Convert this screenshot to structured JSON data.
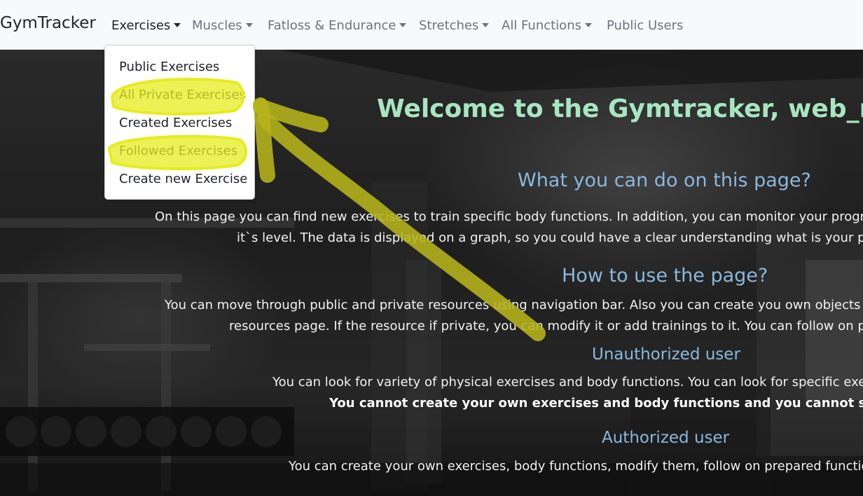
{
  "navbar": {
    "brand": "GymTracker",
    "items": [
      {
        "label": "Exercises"
      },
      {
        "label": "Muscles"
      },
      {
        "label": "Fatloss & Endurance"
      },
      {
        "label": "Stretches"
      },
      {
        "label": "All Functions"
      },
      {
        "label": "Public Users"
      }
    ]
  },
  "dropdown": {
    "items": [
      {
        "label": "Public Exercises"
      },
      {
        "label": "All Private Exercises"
      },
      {
        "label": "Created Exercises"
      },
      {
        "label": "Followed Exercises"
      },
      {
        "label": "Create new Exercise"
      }
    ]
  },
  "main": {
    "welcome": "Welcome to the Gymtracker, web_mod",
    "what_heading": "What you can do on this page?",
    "what_line1": "On this page you can find new exercises to train specific body functions. In addition, you can monitor your progress",
    "what_line2": "it`s level. The data is displayed on a graph, so you could have a clear understanding what is your prog",
    "how_heading": "How to use the page?",
    "how_line1": "You can move through public and private resources using navigation bar. Also you can create you own objects wit",
    "how_line2": "resources page. If the resource if private, you can modify it or add trainings to it. You can follow on pub",
    "unauth_heading": "Unauthorized user",
    "unauth_line1": "You can look for variety of physical exercises and body functions. You can look for specific exerci",
    "unauth_line2": "You cannot create your own exercises and body functions and you cannot save yo",
    "auth_heading": "Authorized user",
    "auth_line1": "You can create your own exercises, body functions, modify them, follow on prepared function"
  },
  "colors": {
    "heading_green": "#a8e6c1",
    "heading_blue": "#8ab8de",
    "highlight_yellow": "#e6ec1e",
    "annotation_olive": "#b7b41b"
  },
  "icons": {
    "dropdown_caret": "caret-down-icon"
  }
}
